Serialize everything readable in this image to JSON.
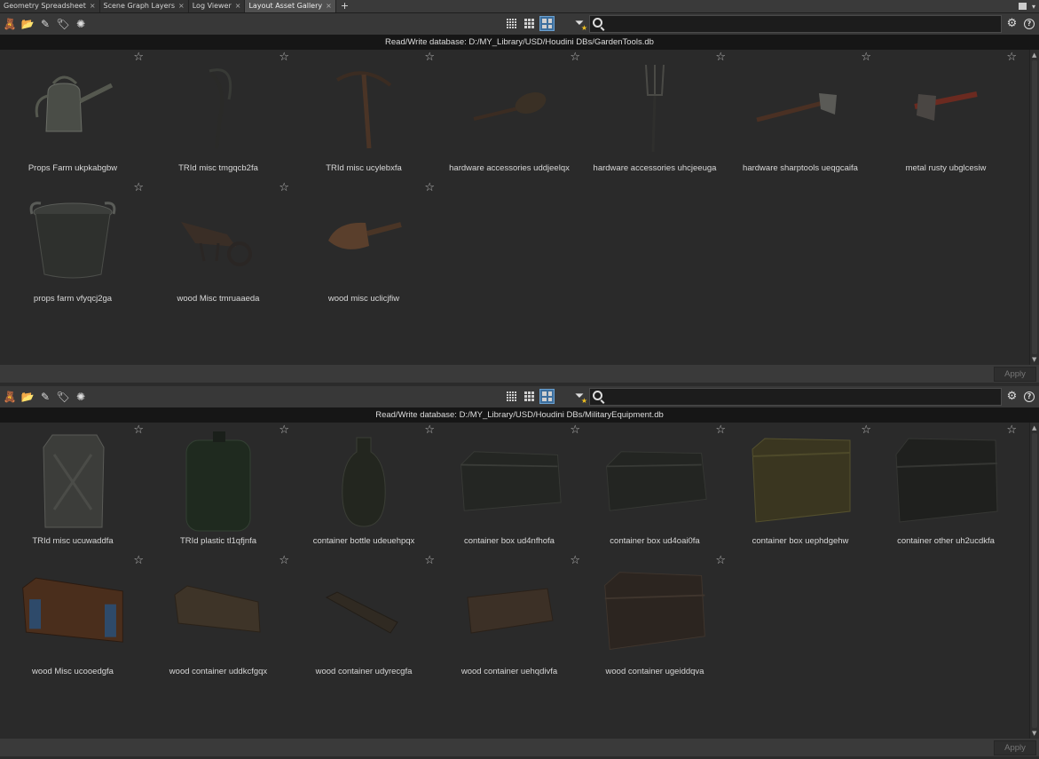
{
  "tabs": [
    {
      "label": "Geometry Spreadsheet",
      "active": false
    },
    {
      "label": "Scene Graph Layers",
      "active": false
    },
    {
      "label": "Log Viewer",
      "active": false
    },
    {
      "label": "Layout Asset Gallery",
      "active": true
    }
  ],
  "tab_add": "+",
  "tab_close_glyph": "×",
  "icons": {
    "toolbar_left": [
      "bear-icon",
      "folder-open-icon",
      "pencil-icon",
      "tag-icon",
      "gear-icon"
    ],
    "view_modes": [
      "grid-small-icon",
      "grid-medium-icon",
      "grid-large-icon"
    ],
    "filter": "filter-favorites-icon",
    "search": "search-icon",
    "settings": "settings-icon",
    "help": "help-icon",
    "favorite": "star-icon"
  },
  "colors": {
    "active_view_button": "#3d6f9e",
    "path_bar_bg": "#161616",
    "favorite_star": "#f0c020"
  },
  "panes": [
    {
      "db_path": "Read/Write database: D:/MY_Library/USD/Houdini DBs/GardenTools.db",
      "search_value": "",
      "apply_label": "Apply",
      "items": [
        {
          "label": "Props Farm ukpkabgbw",
          "thumb": "watering-can"
        },
        {
          "label": "TRId misc tmgqcb2fa",
          "thumb": "scythe"
        },
        {
          "label": "TRId misc ucylebxfa",
          "thumb": "pickaxe"
        },
        {
          "label": "hardware accessories uddjeelqx",
          "thumb": "shovel"
        },
        {
          "label": "hardware accessories uhcjeeuga",
          "thumb": "pitchfork"
        },
        {
          "label": "hardware sharptools ueqgcaifa",
          "thumb": "axe"
        },
        {
          "label": "metal rusty ubglcesiw",
          "thumb": "hatchet"
        },
        {
          "label": "props farm vfyqcj2ga",
          "thumb": "bucket"
        },
        {
          "label": "wood Misc tmruaaeda",
          "thumb": "wheelbarrow"
        },
        {
          "label": "wood misc uclicjfiw",
          "thumb": "scoop"
        }
      ]
    },
    {
      "db_path": "Read/Write database: D:/MY_Library/USD/Houdini DBs/MilitaryEquipment.db",
      "search_value": "",
      "apply_label": "Apply",
      "items": [
        {
          "label": "TRId misc ucuwaddfa",
          "thumb": "jerrycan"
        },
        {
          "label": "TRId plastic tl1qfjnfa",
          "thumb": "canister"
        },
        {
          "label": "container bottle udeuehpqx",
          "thumb": "canteen"
        },
        {
          "label": "container box ud4nfhofa",
          "thumb": "box-dark"
        },
        {
          "label": "container box ud4oai0fa",
          "thumb": "box-dark2"
        },
        {
          "label": "container box uephdgehw",
          "thumb": "box-olive"
        },
        {
          "label": "container other uh2ucdkfa",
          "thumb": "chest-dark"
        },
        {
          "label": "wood Misc ucooedgfa",
          "thumb": "crate-wood"
        },
        {
          "label": "wood container uddkcfgqx",
          "thumb": "crate-long"
        },
        {
          "label": "wood container udyrecgfa",
          "thumb": "crate-thin"
        },
        {
          "label": "wood container uehqdivfa",
          "thumb": "crate-long2"
        },
        {
          "label": "wood container ugeiddqva",
          "thumb": "chest-wood"
        }
      ]
    }
  ]
}
